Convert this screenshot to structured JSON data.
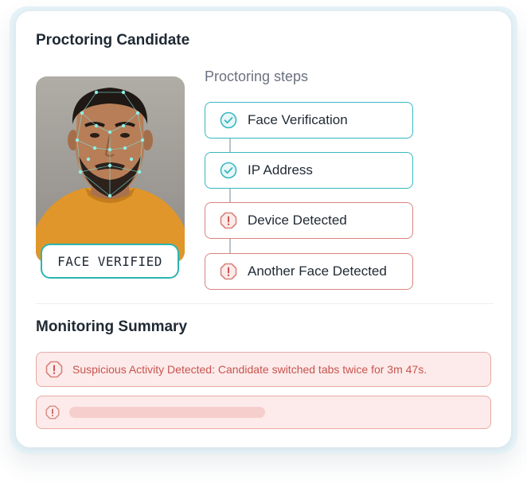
{
  "card": {
    "title": "Proctoring Candidate"
  },
  "photo": {
    "badge_label": "FACE VERIFIED"
  },
  "steps": {
    "heading": "Proctoring steps",
    "items": [
      {
        "label": "Face Verification",
        "status": "ok",
        "icon": "check-circle-icon"
      },
      {
        "label": "IP Address",
        "status": "ok",
        "icon": "check-circle-icon"
      },
      {
        "label": "Device Detected",
        "status": "alert",
        "icon": "alert-octagon-icon"
      },
      {
        "label": "Another Face Detected",
        "status": "alert",
        "icon": "alert-octagon-icon"
      }
    ]
  },
  "summary": {
    "title": "Monitoring Summary",
    "alerts": [
      {
        "message": "Suspicious Activity Detected: Candidate switched tabs twice for 3m 47s.",
        "icon": "alert-octagon-icon"
      },
      {
        "message": "",
        "icon": "alert-octagon-icon"
      }
    ]
  },
  "colors": {
    "ok_accent": "#36b8c0",
    "alert_accent": "#d8847e",
    "alert_background": "#fcebea",
    "alert_text": "#c9534e"
  }
}
